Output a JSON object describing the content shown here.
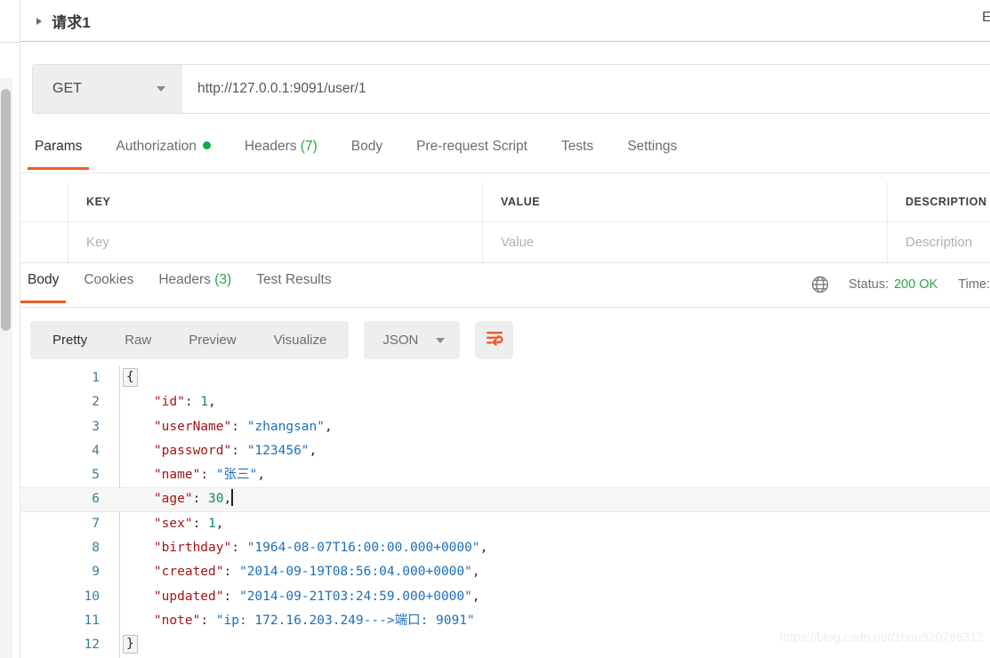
{
  "request_header": {
    "title": "请求1",
    "expand_icon": "caret-right-icon",
    "right_cut_label": "Examples"
  },
  "url_bar": {
    "method": "GET",
    "method_dropdown_icon": "chevron-down-icon",
    "url": "http://127.0.0.1:9091/user/1"
  },
  "request_tabs": {
    "active": "Params",
    "items": [
      {
        "label": "Params",
        "badge": "",
        "dot": false
      },
      {
        "label": "Authorization",
        "badge": "",
        "dot": true
      },
      {
        "label": "Headers",
        "badge": "(7)",
        "dot": false
      },
      {
        "label": "Body",
        "badge": "",
        "dot": false
      },
      {
        "label": "Pre-request Script",
        "badge": "",
        "dot": false
      },
      {
        "label": "Tests",
        "badge": "",
        "dot": false
      },
      {
        "label": "Settings",
        "badge": "",
        "dot": false
      }
    ]
  },
  "params_table": {
    "headers": [
      "KEY",
      "VALUE",
      "DESCRIPTION"
    ],
    "row_placeholders": [
      "Key",
      "Value",
      "Description"
    ]
  },
  "response_tabs": {
    "active": "Body",
    "items": [
      {
        "label": "Body",
        "badge": ""
      },
      {
        "label": "Cookies",
        "badge": ""
      },
      {
        "label": "Headers",
        "badge": "(3)"
      },
      {
        "label": "Test Results",
        "badge": ""
      }
    ]
  },
  "response_status": {
    "globe_icon": "globe-icon",
    "status_label": "Status:",
    "status_code": "200 OK",
    "time_label": "Time:"
  },
  "format_bar": {
    "segments": [
      "Pretty",
      "Raw",
      "Preview",
      "Visualize"
    ],
    "active_segment": "Pretty",
    "language": "JSON",
    "language_dropdown_icon": "chevron-down-icon",
    "wrap_button_icon": "word-wrap-icon"
  },
  "code": {
    "active_line": 6,
    "lines": [
      {
        "n": "1",
        "tokens": [
          {
            "t": "fold",
            "v": "{"
          }
        ]
      },
      {
        "n": "2",
        "tokens": [
          {
            "t": "plain",
            "v": "    "
          },
          {
            "t": "key",
            "v": "\"id\""
          },
          {
            "t": "punct",
            "v": ": "
          },
          {
            "t": "num",
            "v": "1"
          },
          {
            "t": "punct",
            "v": ","
          }
        ]
      },
      {
        "n": "3",
        "tokens": [
          {
            "t": "plain",
            "v": "    "
          },
          {
            "t": "key",
            "v": "\"userName\""
          },
          {
            "t": "punct",
            "v": ": "
          },
          {
            "t": "str",
            "v": "\"zhangsan\""
          },
          {
            "t": "punct",
            "v": ","
          }
        ]
      },
      {
        "n": "4",
        "tokens": [
          {
            "t": "plain",
            "v": "    "
          },
          {
            "t": "key",
            "v": "\"password\""
          },
          {
            "t": "punct",
            "v": ": "
          },
          {
            "t": "str",
            "v": "\"123456\""
          },
          {
            "t": "punct",
            "v": ","
          }
        ]
      },
      {
        "n": "5",
        "tokens": [
          {
            "t": "plain",
            "v": "    "
          },
          {
            "t": "key",
            "v": "\"name\""
          },
          {
            "t": "punct",
            "v": ": "
          },
          {
            "t": "str",
            "v": "\"张三\""
          },
          {
            "t": "punct",
            "v": ","
          }
        ]
      },
      {
        "n": "6",
        "tokens": [
          {
            "t": "plain",
            "v": "    "
          },
          {
            "t": "key",
            "v": "\"age\""
          },
          {
            "t": "punct",
            "v": ": "
          },
          {
            "t": "num",
            "v": "30"
          },
          {
            "t": "punct",
            "v": ","
          },
          {
            "t": "caret",
            "v": ""
          }
        ]
      },
      {
        "n": "7",
        "tokens": [
          {
            "t": "plain",
            "v": "    "
          },
          {
            "t": "key",
            "v": "\"sex\""
          },
          {
            "t": "punct",
            "v": ": "
          },
          {
            "t": "num",
            "v": "1"
          },
          {
            "t": "punct",
            "v": ","
          }
        ]
      },
      {
        "n": "8",
        "tokens": [
          {
            "t": "plain",
            "v": "    "
          },
          {
            "t": "key",
            "v": "\"birthday\""
          },
          {
            "t": "punct",
            "v": ": "
          },
          {
            "t": "str",
            "v": "\"1964-08-07T16:00:00.000+0000\""
          },
          {
            "t": "punct",
            "v": ","
          }
        ]
      },
      {
        "n": "9",
        "tokens": [
          {
            "t": "plain",
            "v": "    "
          },
          {
            "t": "key",
            "v": "\"created\""
          },
          {
            "t": "punct",
            "v": ": "
          },
          {
            "t": "str",
            "v": "\"2014-09-19T08:56:04.000+0000\""
          },
          {
            "t": "punct",
            "v": ","
          }
        ]
      },
      {
        "n": "10",
        "tokens": [
          {
            "t": "plain",
            "v": "    "
          },
          {
            "t": "key",
            "v": "\"updated\""
          },
          {
            "t": "punct",
            "v": ": "
          },
          {
            "t": "str",
            "v": "\"2014-09-21T03:24:59.000+0000\""
          },
          {
            "t": "punct",
            "v": ","
          }
        ]
      },
      {
        "n": "11",
        "tokens": [
          {
            "t": "plain",
            "v": "    "
          },
          {
            "t": "key",
            "v": "\"note\""
          },
          {
            "t": "punct",
            "v": ": "
          },
          {
            "t": "str",
            "v": "\"ip: 172.16.203.249--->端口: 9091\""
          }
        ]
      },
      {
        "n": "12",
        "tokens": [
          {
            "t": "fold",
            "v": "}"
          }
        ]
      }
    ]
  },
  "watermark": "https://blog.csdn.net/zhou920786312"
}
